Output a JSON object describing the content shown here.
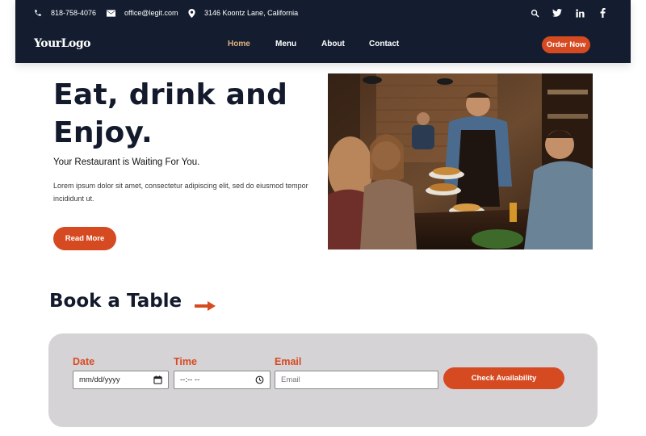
{
  "contact": {
    "phone": "818-758-4076",
    "email": "office@legit.com",
    "address": "3146 Koontz Lane, California"
  },
  "social_icons": [
    "search-icon",
    "twitter-icon",
    "linkedin-icon",
    "facebook-icon"
  ],
  "header": {
    "logo": "YourLogo",
    "nav": [
      {
        "label": "Home",
        "active": true
      },
      {
        "label": "Menu",
        "active": false
      },
      {
        "label": "About",
        "active": false
      },
      {
        "label": "Contact",
        "active": false
      }
    ],
    "order_button": "Order Now"
  },
  "hero": {
    "title_line1": "Eat, drink and",
    "title_line2": "Enjoy.",
    "subtitle": "Your Restaurant is Waiting For You.",
    "paragraph": "Lorem ipsum dolor sit amet, consectetur adipiscing elit, sed do eiusmod tempor incididunt ut.",
    "button": "Read More"
  },
  "booking": {
    "title": "Book a Table",
    "date_label": "Date",
    "date_value": "mm/dd/yyyy",
    "time_label": "Time",
    "time_value": "--:-- --",
    "email_label": "Email",
    "email_placeholder": "Email",
    "button": "Check Availability"
  },
  "colors": {
    "header_bg": "#131d2f",
    "accent": "#d64a21",
    "nav_active": "#e4b27e",
    "panel_bg": "#d5d3d6",
    "heading": "#131a2c"
  }
}
